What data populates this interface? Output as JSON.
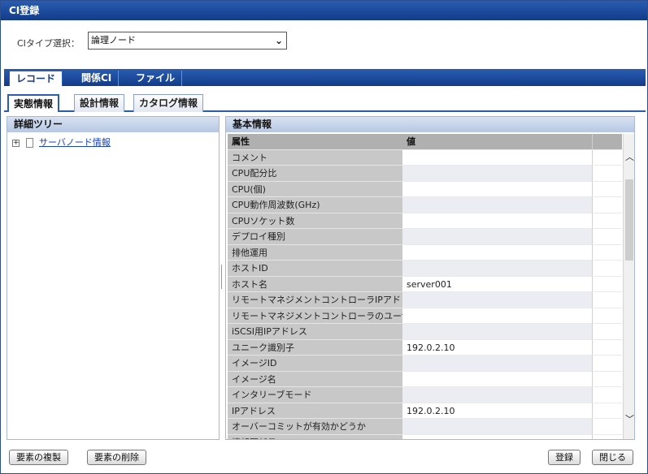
{
  "window": {
    "title": "CI登録"
  },
  "ci_type": {
    "label": "CIタイプ選択：",
    "selected": "論理ノード"
  },
  "record_tabs": [
    "レコード",
    "関係CI",
    "ファイル"
  ],
  "sub_tabs": [
    "実態情報",
    "設計情報",
    "カタログ情報"
  ],
  "tree": {
    "header": "詳細ツリー",
    "toggle": "+",
    "item": "サーバノード情報"
  },
  "basic": {
    "header": "基本情報",
    "columns": {
      "attr": "属性",
      "value": "値"
    },
    "rows": [
      {
        "attr": "コメント",
        "value": ""
      },
      {
        "attr": "CPU配分比",
        "value": ""
      },
      {
        "attr": "CPU(個)",
        "value": ""
      },
      {
        "attr": "CPU動作周波数(GHz)",
        "value": ""
      },
      {
        "attr": "CPUソケット数",
        "value": ""
      },
      {
        "attr": "デプロイ種別",
        "value": ""
      },
      {
        "attr": "排他運用",
        "value": ""
      },
      {
        "attr": "ホストID",
        "value": ""
      },
      {
        "attr": "ホスト名",
        "value": "server001"
      },
      {
        "attr": "リモートマネジメントコントローラIPアドレ",
        "value": ""
      },
      {
        "attr": "リモートマネジメントコントローラのユーザ",
        "value": ""
      },
      {
        "attr": "iSCSI用IPアドレス",
        "value": ""
      },
      {
        "attr": "ユニーク識別子",
        "value": "192.0.2.10"
      },
      {
        "attr": "イメージID",
        "value": ""
      },
      {
        "attr": "イメージ名",
        "value": ""
      },
      {
        "attr": "インタリーブモード",
        "value": ""
      },
      {
        "attr": "IPアドレス",
        "value": "192.0.2.10"
      },
      {
        "attr": "オーバーコミットが有効かどうか",
        "value": ""
      },
      {
        "attr": "情報更新日",
        "value": ""
      }
    ]
  },
  "buttons": {
    "duplicate": "要素の複製",
    "delete": "要素の削除",
    "register": "登録",
    "close": "閉じる"
  },
  "scroll_position": 0.15
}
